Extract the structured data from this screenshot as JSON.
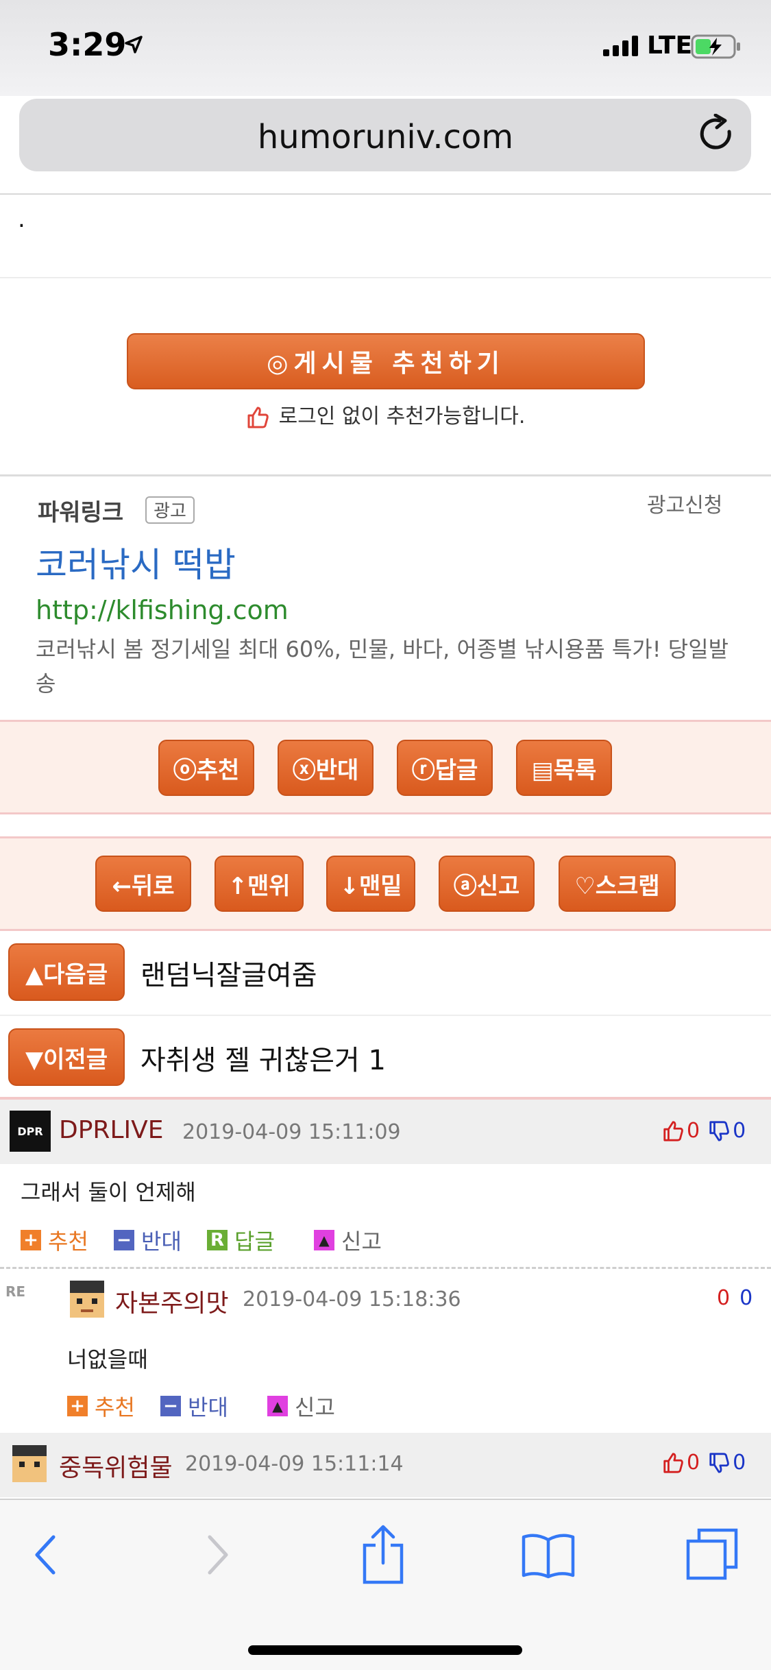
{
  "status_bar": {
    "time": "3:29",
    "network": "LTE"
  },
  "browser": {
    "url": "humoruniv.com"
  },
  "post": {
    "dot": ".",
    "recommend_button": "◎게시물  추천하기",
    "login_note": "로그인 없이 추천가능합니다."
  },
  "ad": {
    "powerlink": "파워링크",
    "tag": "광고",
    "request": "광고신청",
    "title": "코러낚시 떡밥",
    "url": "http://klfishing.com",
    "description": "코러낚시 봄 정기세일 최대 60%, 민물, 바다, 어종별 낚시용품 특가! 당일발송"
  },
  "actions_row1": [
    "ⓞ추천",
    "ⓧ반대",
    "ⓡ답글",
    "▤목록"
  ],
  "actions_row2": [
    "←뒤로",
    "↑맨위",
    "↓맨밑",
    "ⓐ신고",
    "♡스크랩"
  ],
  "navigation": {
    "next_label": "▲다음글",
    "next_title": "랜덤닉잘글여줌",
    "prev_label": "▼이전글",
    "prev_title": "자취생 젤 귀찮은거 1"
  },
  "comments": [
    {
      "avatar_text": "DPR",
      "author": "DPRLIVE",
      "date": "2019-04-09 15:11:09",
      "up": "0",
      "down": "0",
      "body": "그래서 둘이 언제해",
      "actions": [
        "추천",
        "반대",
        "답글",
        "신고"
      ]
    },
    {
      "reply_tag": "RE",
      "author": "자본주의맛",
      "date": "2019-04-09 15:18:36",
      "up": "0",
      "down": "0",
      "body": "너없을때",
      "actions": [
        "추천",
        "반대",
        "신고"
      ]
    },
    {
      "author": "중독위험물",
      "date": "2019-04-09 15:11:14",
      "up": "0",
      "down": "0"
    }
  ],
  "colors": {
    "accent_orange": "#d95d20",
    "link_blue": "#2a6ac3",
    "url_green": "#2d8b2d",
    "ios_blue": "#3478f6"
  },
  "toolbar_icons": [
    "back-icon",
    "forward-icon",
    "share-icon",
    "bookmarks-icon",
    "tabs-icon"
  ]
}
